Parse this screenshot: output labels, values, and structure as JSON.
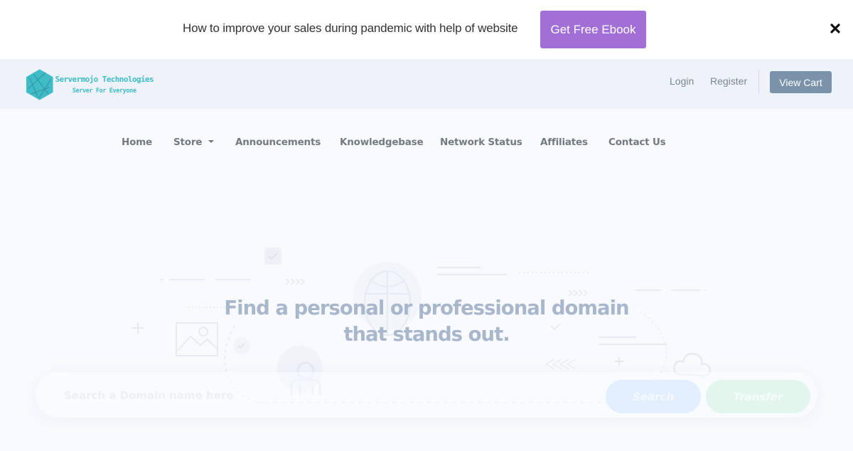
{
  "promo": {
    "text": "How to improve your sales during pandemic with help of website",
    "button_label": "Get Free Ebook",
    "close_icon": "close-icon",
    "button_color": "#a16fd6"
  },
  "header": {
    "logo": {
      "name": "Servermojo Technologies",
      "tagline": "Server For Everyone",
      "color": "#3fbcc8"
    },
    "login_label": "Login",
    "register_label": "Register",
    "view_cart_label": "View Cart"
  },
  "nav": {
    "items": [
      {
        "label": "Home"
      },
      {
        "label": "Store",
        "has_dropdown": true
      },
      {
        "label": "Announcements"
      },
      {
        "label": "Knowledgebase"
      },
      {
        "label": "Network Status"
      },
      {
        "label": "Affiliates"
      },
      {
        "label": "Contact Us"
      }
    ]
  },
  "hero": {
    "title_line1": "Find a personal or professional domain",
    "title_line2": "that stands out.",
    "search_placeholder": "Search a Domain name here",
    "search_button": "Search",
    "transfer_button": "Transfer"
  }
}
